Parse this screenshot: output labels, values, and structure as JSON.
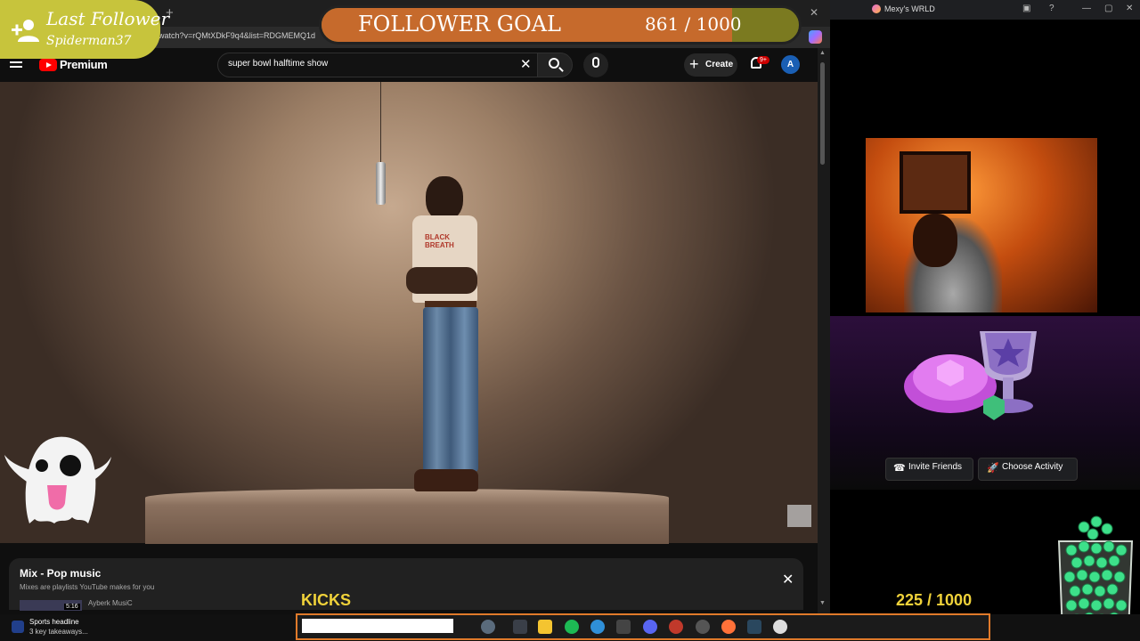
{
  "browser": {
    "url": "watch?v=rQMtXDkF9q4&list=RDGMEMQ1d",
    "new_tab_symbol": "+",
    "close_symbol": "✕"
  },
  "youtube": {
    "brand": "Premium",
    "search": {
      "value": "super bowl halftime show",
      "clear_symbol": "✕"
    },
    "create_label": "Create",
    "create_symbol": "+",
    "notification_badge": "9+",
    "avatar_letter": "A"
  },
  "video": {
    "shirt_text": "BLACK BREATH"
  },
  "mix_panel": {
    "title": "Mix - Pop music",
    "subtitle": "Mixes are playlists YouTube makes for you",
    "close_symbol": "✕",
    "item": {
      "duration": "5:16",
      "author": "Ayberk MusiC"
    }
  },
  "scrollbar": {
    "up_symbol": "▲",
    "down_symbol": "▼"
  },
  "overlays": {
    "last_follower_title": "Last Follower",
    "last_follower_name": "Spiderman37",
    "goal_label": "FOLLOWER GOAL",
    "goal_count": "861 / 1000",
    "goal_current": 861,
    "goal_target": 1000,
    "kicks_label": "KICKS",
    "kicks_count": "225 / 1000"
  },
  "discord": {
    "window_title": "Mexy's WRLD",
    "invite_label": "Invite Friends",
    "activity_label": "Choose Activity",
    "invite_icon": "☎",
    "activity_icon": "🚀"
  },
  "taskbar": {
    "news_title": "Sports headline",
    "news_sub": "3 key takeaways..."
  },
  "colors": {
    "youtube_red": "#ff0000",
    "goal_fill": "#c66a2c",
    "goal_track": "#7b7a20",
    "follower_badge": "#c7c43c",
    "kicks_text": "#f0d23a",
    "taskbar_border": "#e07a2a"
  }
}
